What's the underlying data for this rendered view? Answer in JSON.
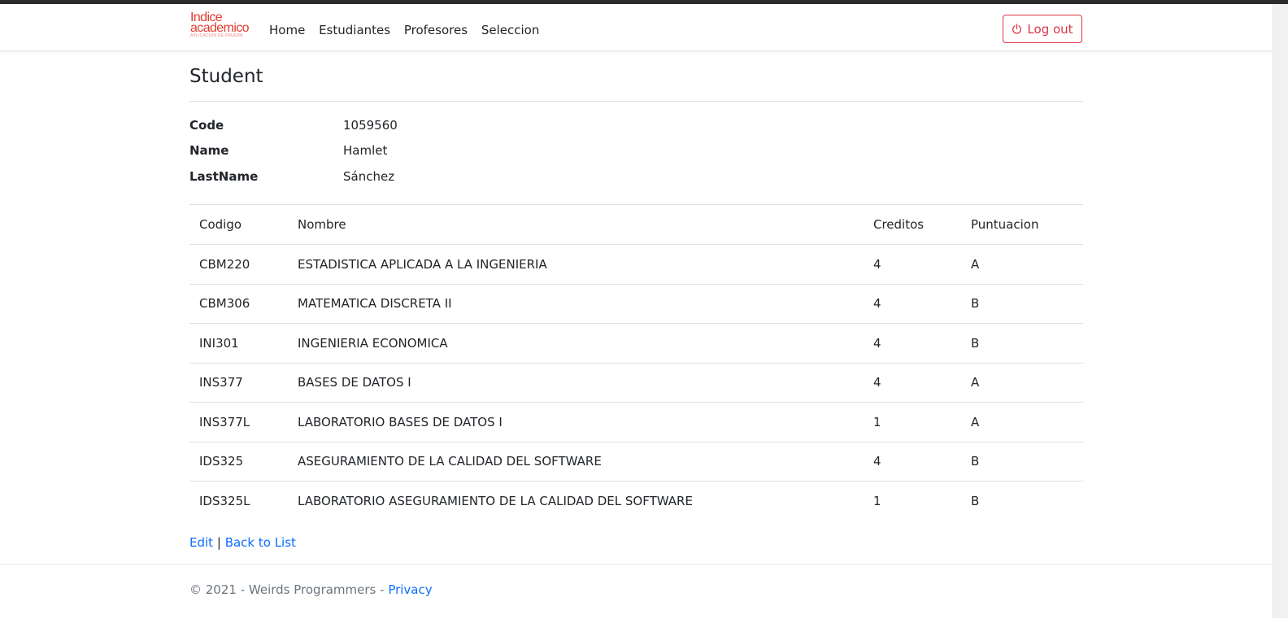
{
  "brand": {
    "line1": "Indice",
    "line2": "academico",
    "tagline": "APLICACION DE PRUEBA"
  },
  "nav": {
    "items": [
      "Home",
      "Estudiantes",
      "Profesores",
      "Seleccion"
    ],
    "logout_label": "Log out",
    "logout_icon": "power-icon"
  },
  "page": {
    "title": "Student"
  },
  "details": [
    {
      "label": "Code",
      "value": "1059560"
    },
    {
      "label": "Name",
      "value": "Hamlet"
    },
    {
      "label": "LastName",
      "value": "Sánchez"
    }
  ],
  "table": {
    "headers": [
      "Codigo",
      "Nombre",
      "Creditos",
      "Puntuacion"
    ],
    "rows": [
      [
        "CBM220",
        "ESTADISTICA APLICADA A LA INGENIERIA",
        "4",
        "A"
      ],
      [
        "CBM306",
        "MATEMATICA DISCRETA II",
        "4",
        "B"
      ],
      [
        "INI301",
        "INGENIERIA ECONOMICA",
        "4",
        "B"
      ],
      [
        "INS377",
        "BASES DE DATOS I",
        "4",
        "A"
      ],
      [
        "INS377L",
        "LABORATORIO BASES DE DATOS I",
        "1",
        "A"
      ],
      [
        "IDS325",
        "ASEGURAMIENTO DE LA CALIDAD DEL SOFTWARE",
        "4",
        "B"
      ],
      [
        "IDS325L",
        "LABORATORIO ASEGURAMIENTO DE LA CALIDAD DEL SOFTWARE",
        "1",
        "B"
      ]
    ]
  },
  "links": {
    "edit": "Edit",
    "separator": "|",
    "back": "Back to List"
  },
  "footer": {
    "text": "© 2021 - Weirds Programmers - ",
    "privacy": "Privacy"
  },
  "colors": {
    "accent": "#0d6efd",
    "danger": "#dc3545",
    "brand": "#e33b2e"
  }
}
